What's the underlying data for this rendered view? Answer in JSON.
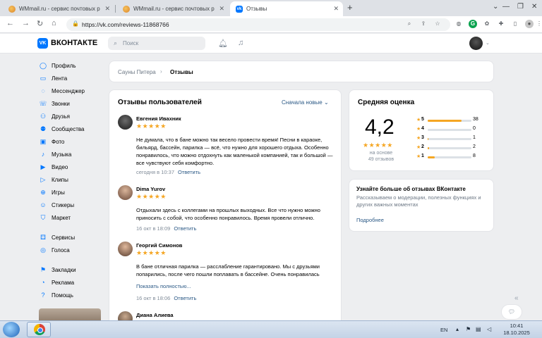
{
  "browser": {
    "tabs": [
      {
        "title": "WMmail.ru - сервис почтовых р",
        "active": false
      },
      {
        "title": "WMmail.ru - сервис почтовых р",
        "active": false
      },
      {
        "title": "Отзывы",
        "active": true
      }
    ],
    "url": "https://vk.com/reviews-11868766"
  },
  "vk": {
    "logo_text": "ВКОНТАКТЕ",
    "search_placeholder": "Поиск"
  },
  "sidebar": {
    "items": [
      {
        "label": "Профиль",
        "icon": "user-icon"
      },
      {
        "label": "Лента",
        "icon": "feed-icon"
      },
      {
        "label": "Мессенджер",
        "icon": "message-icon"
      },
      {
        "label": "Звонки",
        "icon": "phone-icon"
      },
      {
        "label": "Друзья",
        "icon": "friends-icon"
      },
      {
        "label": "Сообщества",
        "icon": "groups-icon"
      },
      {
        "label": "Фото",
        "icon": "photo-icon"
      },
      {
        "label": "Музыка",
        "icon": "music-icon"
      },
      {
        "label": "Видео",
        "icon": "video-icon"
      },
      {
        "label": "Клипы",
        "icon": "clips-icon"
      },
      {
        "label": "Игры",
        "icon": "games-icon"
      },
      {
        "label": "Стикеры",
        "icon": "stickers-icon"
      },
      {
        "label": "Маркет",
        "icon": "market-icon"
      },
      {
        "label": "Сервисы",
        "icon": "services-icon"
      },
      {
        "label": "Голоса",
        "icon": "votes-icon"
      },
      {
        "label": "Закладки",
        "icon": "bookmark-icon"
      },
      {
        "label": "Реклама",
        "icon": "ads-icon"
      },
      {
        "label": "Помощь",
        "icon": "help-icon"
      }
    ]
  },
  "breadcrumb": {
    "parent": "Сауны Питера",
    "current": "Отзывы"
  },
  "reviews": {
    "title": "Отзывы пользователей",
    "sort_label": "Сначала новые",
    "items": [
      {
        "name": "Евгения Иваxник",
        "stars": "★★★★★",
        "text": "Не думала, что в бане можно так весело провести время! Песни в караоке, бильярд, бассейн, парилка — всё, что нужно для хорошего отдыха. Особенно понравилось, что можно отдохнуть как маленькой компанией, так и большой — все чувствуют себя комфортно.",
        "date": "сегодня в 10:37",
        "reply": "Ответить"
      },
      {
        "name": "Dima Yurov",
        "stars": "★★★★★",
        "text": "Отдыхали здесь с коллегами на прошлых выходных. Все что нужно можно приносить с собой, что особенно понравилось. Время провели отлично.",
        "date": "16 окт в 18:09",
        "reply": "Ответить"
      },
      {
        "name": "Георгий Симонов",
        "stars": "★★★★★",
        "text": "В бане отличная парилка — расслабление гарантировано. Мы с друзьями попарились, после чего пошли поплавать в бассейне. Очень понравилась атмосфера — тихо, спокойно, а самое главное — всё по-домашнему уютно...",
        "more": "Показать полностью...",
        "date": "16 окт в 18:06",
        "reply": "Ответить"
      },
      {
        "name": "Диана Алиева"
      }
    ]
  },
  "rating": {
    "title": "Средняя оценка",
    "value": "4,2",
    "stars": "★★★★★",
    "based_on": "на основе",
    "count_text": "49 отзывов",
    "rows": [
      {
        "label": "5",
        "count": "38",
        "fraction": 0.78
      },
      {
        "label": "4",
        "count": "0",
        "fraction": 0.0
      },
      {
        "label": "3",
        "count": "1",
        "fraction": 0.02
      },
      {
        "label": "2",
        "count": "2",
        "fraction": 0.04
      },
      {
        "label": "1",
        "count": "8",
        "fraction": 0.16
      }
    ]
  },
  "learn_more": {
    "title": "Узнайте больше об отзывах ВКонтакте",
    "text": "Рассказываем о модерации, полезных функциях и других важных моментах",
    "link": "Подробнее"
  },
  "taskbar": {
    "lang": "EN",
    "time": "10:41",
    "date": "18.10.2025"
  },
  "colors": {
    "vk_blue": "#0077ff",
    "star": "#f5a623",
    "link": "#2a5885"
  }
}
